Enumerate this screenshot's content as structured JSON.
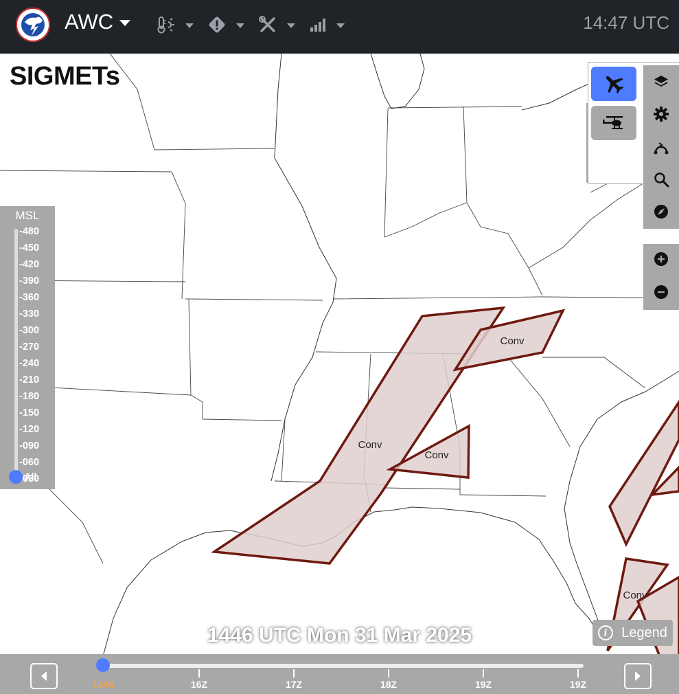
{
  "header": {
    "brand": "AWC",
    "clock": "14:47 UTC",
    "nav_icons": [
      "thermometer-sun-icon",
      "warning-diamond-icon",
      "tools-icon",
      "signal-bars-icon"
    ]
  },
  "page_title": "SIGMETs",
  "modes": {
    "fixed_wing": "airplane-icon",
    "helicopter": "helicopter-icon",
    "active": "fixed_wing",
    "active_color": "#4f7cff"
  },
  "tools": [
    "layers-icon",
    "gear-icon",
    "route-icon",
    "search-icon",
    "compass-icon"
  ],
  "zoom": [
    "zoom-in-icon",
    "zoom-out-icon"
  ],
  "altitude": {
    "title": "MSL",
    "levels": [
      "480",
      "450",
      "420",
      "390",
      "360",
      "330",
      "300",
      "270",
      "240",
      "210",
      "180",
      "150",
      "120",
      "090",
      "060",
      "030",
      "010"
    ],
    "all_label": "All"
  },
  "valid_time": "1446 UTC Mon 31 Mar 2025",
  "legend_label": "Legend",
  "timeline": {
    "current": "1446",
    "ticks": [
      "16Z",
      "17Z",
      "18Z",
      "19Z",
      "19Z"
    ],
    "position": 0
  },
  "sigmets": {
    "label": "Conv",
    "fill": "#e1cfcf",
    "stroke": "#6e1a10"
  }
}
